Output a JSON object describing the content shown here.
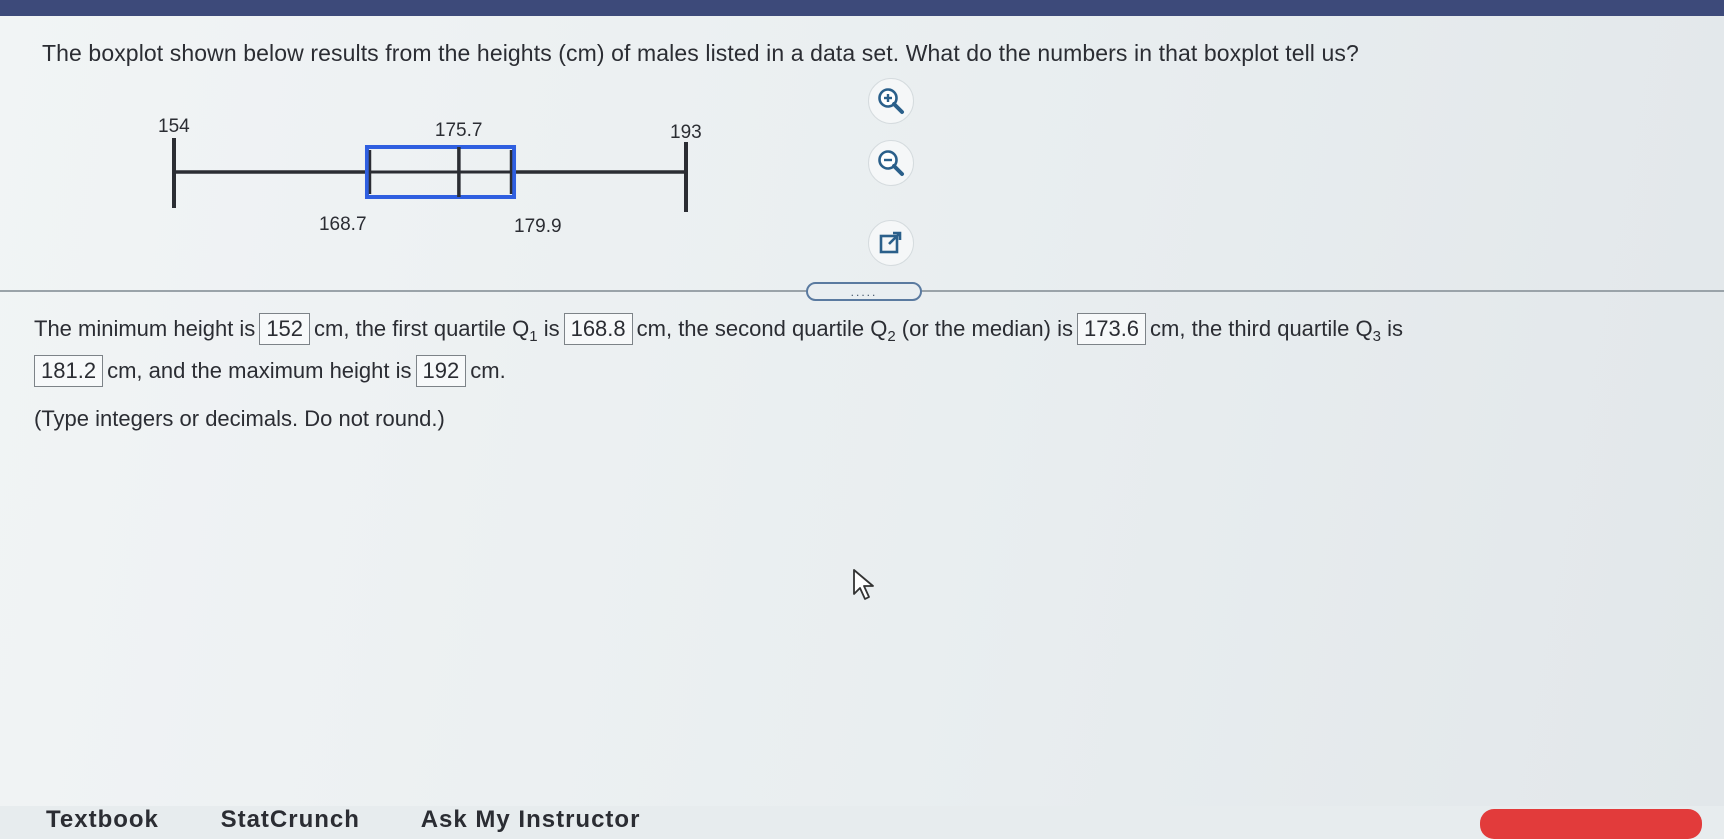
{
  "question": "The boxplot shown below results from the heights (cm) of males listed in a data set. What do the numbers in that boxplot tell us?",
  "boxplot": {
    "labels": {
      "min": "154",
      "median": "175.7",
      "max": "193",
      "q1": "168.7",
      "q3": "179.9"
    },
    "values": {
      "min": 154,
      "q1": 168.7,
      "median": 175.7,
      "q3": 179.9,
      "max": 193
    },
    "box_color": "#2f5fe0",
    "whisker_color": "#2b2d33"
  },
  "tools": {
    "zoom_in": "zoom-in-icon",
    "zoom_out": "zoom-out-icon",
    "popout": "popout-icon"
  },
  "divider": {
    "handle_label": "....."
  },
  "answer": {
    "p1": "The minimum height is",
    "min_value": "152",
    "p2": "cm, the first quartile Q",
    "q1_sub": "1",
    "p3": "is",
    "q1_value": "168.8",
    "p4": "cm, the second quartile Q",
    "q2_sub": "2",
    "p5": "(or the median) is",
    "q2_value": "173.6",
    "p6": "cm, the third quartile Q",
    "q3_sub": "3",
    "p7": "is",
    "q3_value": "181.2",
    "p8": "cm, and the maximum height is",
    "max_value": "192",
    "p9": "cm."
  },
  "hint": "(Type integers or decimals. Do not round.)",
  "bottom_tabs": [
    "Textbook",
    "StatCrunch",
    "Ask My Instructor"
  ],
  "colors": {
    "topbar": "#3d4a7a",
    "accent_button": "#e23b3b"
  }
}
